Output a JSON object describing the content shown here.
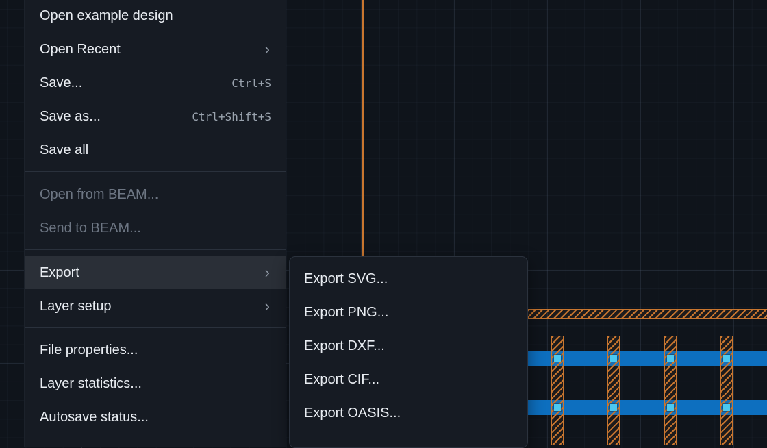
{
  "file_menu": {
    "items": [
      {
        "label": "Open example design",
        "shortcut": ""
      },
      {
        "label": "Open Recent",
        "submenu": true
      },
      {
        "label": "Save...",
        "shortcut": "Ctrl+S"
      },
      {
        "label": "Save as...",
        "shortcut": "Ctrl+Shift+S"
      },
      {
        "label": "Save all"
      },
      {
        "label": "Open from BEAM...",
        "disabled": true
      },
      {
        "label": "Send to BEAM...",
        "disabled": true
      },
      {
        "label": "Export",
        "submenu": true,
        "active": true
      },
      {
        "label": "Layer setup",
        "submenu": true
      },
      {
        "label": "File properties..."
      },
      {
        "label": "Layer statistics..."
      },
      {
        "label": "Autosave status..."
      }
    ]
  },
  "export_submenu": {
    "items": [
      {
        "label": "Export SVG..."
      },
      {
        "label": "Export PNG..."
      },
      {
        "label": "Export DXF..."
      },
      {
        "label": "Export CIF..."
      },
      {
        "label": "Export OASIS..."
      }
    ]
  },
  "icons": {
    "submenu_arrow": "chevron-right-icon"
  },
  "colors": {
    "canvas_bg": "#0f141b",
    "metal_layer": "#0d6fbf",
    "poly_hatch": "#c9762f",
    "via": "#4cc8f0",
    "menu_bg": "#161b23",
    "active_item_bg": "#2a2f37"
  }
}
